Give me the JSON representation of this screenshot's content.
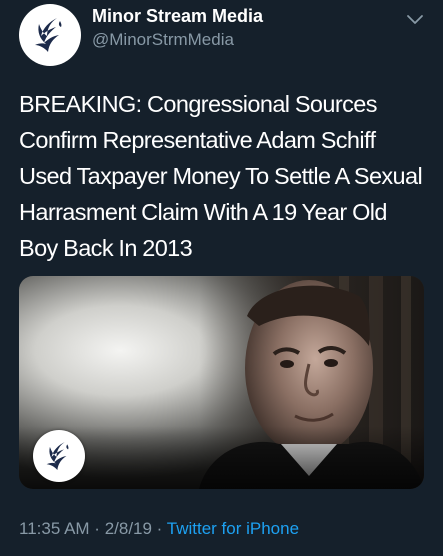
{
  "account": {
    "display_name": "Minor Stream Media",
    "handle": "@MinorStrmMedia",
    "avatar_icon": "stylized-bird-logo-icon"
  },
  "menu": {
    "icon": "chevron-down-icon"
  },
  "tweet": {
    "text": "BREAKING: Congressional Sources Confirm Representative Adam Schiff Used Taxpayer Money To Settle A Sexual Harrasment Claim With A 19 Year Old Boy Back In 2013"
  },
  "media": {
    "watermark_icon": "stylized-bird-logo-icon"
  },
  "meta": {
    "time": "11:35 AM",
    "separator": " · ",
    "date": "2/8/19",
    "source": "Twitter for iPhone"
  },
  "colors": {
    "background": "#15202b",
    "primary_text": "#ffffff",
    "secondary_text": "#8899a6",
    "accent": "#1da1f2",
    "logo_navy": "#1c2a4a"
  }
}
